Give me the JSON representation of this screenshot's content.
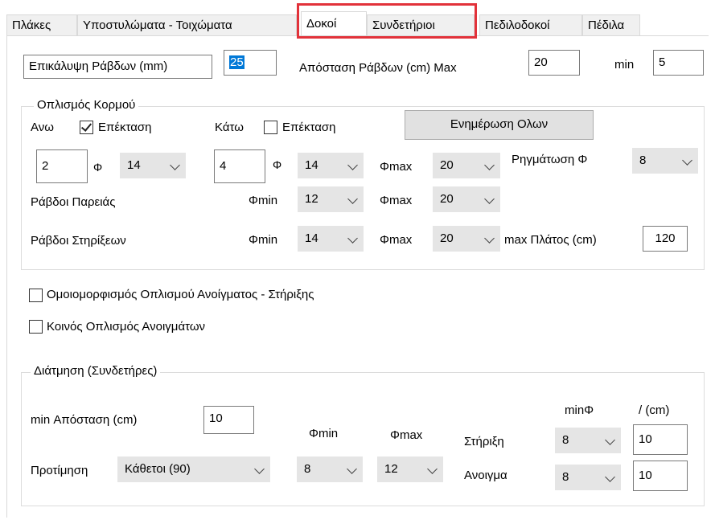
{
  "tabs": [
    "Πλάκες",
    "Υποστυλώματα - Τοιχώματα",
    "Δοκοί",
    "Συνδετήριοι",
    "Πεδιλοδοκοί",
    "Πέδιλα"
  ],
  "cover": {
    "label": "Επικάλυψη Ράβδων (mm)",
    "value": "25"
  },
  "spacing": {
    "label": "Απόσταση Ράβδων (cm) Max",
    "max_value": "20",
    "min_label": "min",
    "min_value": "5"
  },
  "web": {
    "title": "Οπλισμός Κορμού",
    "top_label": "Ανω",
    "top_ext_label": "Επέκταση",
    "top_ext_checked": true,
    "bottom_label": "Κάτω",
    "bottom_ext_label": "Επέκταση",
    "bottom_ext_checked": false,
    "update_button": "Ενημέρωση Ολων",
    "top_count": "2",
    "phi": "Φ",
    "top_phi": "14",
    "bottom_count": "4",
    "bottom_phi": "14",
    "phimax_label": "Φmax",
    "phimax_value": "20",
    "cracking_label": "Ρηγμάτωση Φ",
    "cracking_value": "8",
    "side_label": "Ράβδοι Παρειάς",
    "phimin_label": "Φmin",
    "side_phimin": "12",
    "side_phimax": "20",
    "support_label": "Ράβδοι Στηρίξεων",
    "support_phimin": "14",
    "support_phimax": "20",
    "max_width_label": "max Πλάτος (cm)",
    "max_width_value": "120"
  },
  "uniform_label": "Ομοιομορφισμός Οπλισμού Ανοίγματος - Στήριξης",
  "uniform_checked": false,
  "common_label": "Κοινός Οπλισμός Ανοιγμάτων",
  "common_checked": false,
  "stirrups": {
    "title": "Διάτμηση (Συνδετήρες)",
    "min_dist_label": "min Απόσταση (cm)",
    "min_dist_value": "10",
    "phimin_label": "Φmin",
    "phimax_label": "Φmax",
    "minphi_label": "minΦ",
    "per_cm_label": "/ (cm)",
    "pref_label": "Προτίμηση",
    "pref_value": "Κάθετοι (90)",
    "phimin_value": "8",
    "phimax_value": "12",
    "support_label": "Στήριξη",
    "support_phi": "8",
    "support_cm": "10",
    "span_label": "Ανοιγμα",
    "span_phi": "8",
    "span_cm": "10"
  }
}
